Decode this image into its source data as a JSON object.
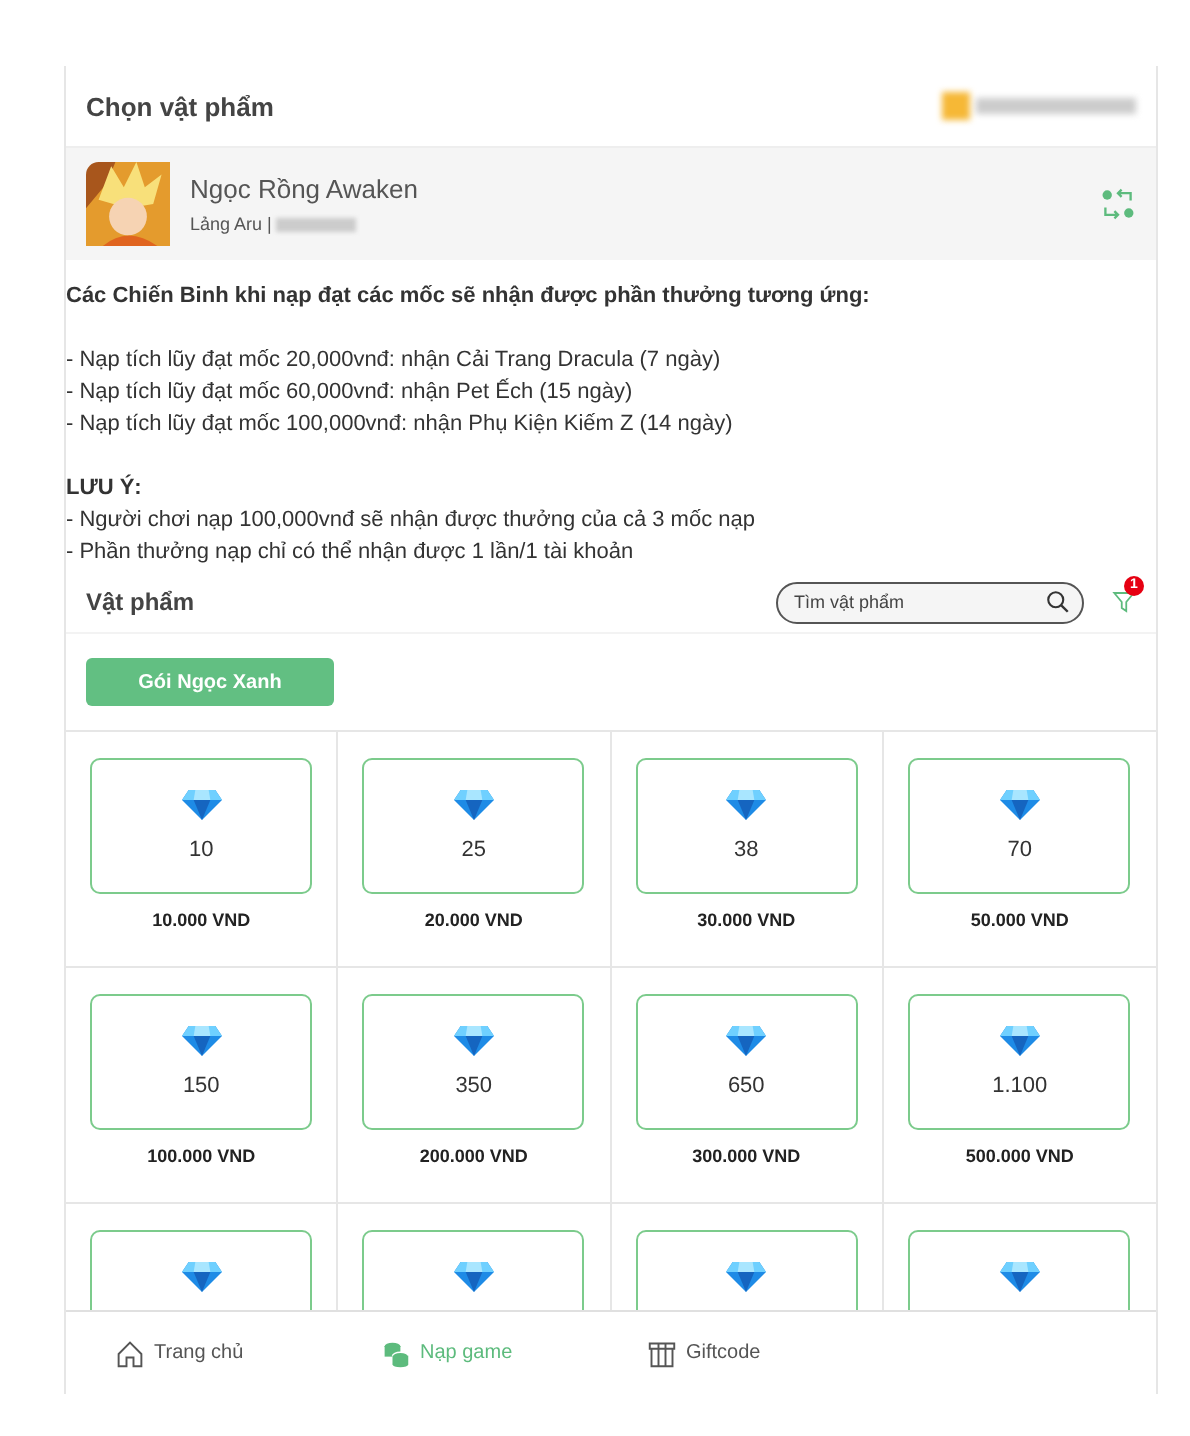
{
  "header": {
    "title": "Chọn vật phẩm"
  },
  "game": {
    "name": "Ngọc Rồng Awaken",
    "server": "Lảng Aru |"
  },
  "notice": {
    "heading": "Các Chiến Binh khi nạp đạt các mốc sẽ nhận được phần thưởng tương ứng:",
    "rewards": [
      "- Nạp tích lũy đạt mốc 20,000vnđ: nhận Cải Trang Dracula (7 ngày)",
      "- Nạp tích lũy đạt mốc 60,000vnđ: nhận Pet Ếch (15 ngày)",
      "- Nạp tích lũy đạt mốc 100,000vnđ: nhận Phụ Kiện Kiếm Z (14 ngày)"
    ],
    "note_heading": "LƯU Ý:",
    "notes": [
      "- Người chơi nạp 100,000vnđ sẽ nhận được thưởng của cả 3 mốc nạp",
      "- Phần thưởng nạp chỉ có thể nhận được 1 lần/1 tài khoản"
    ]
  },
  "items_section": {
    "title": "Vật phẩm",
    "search": {
      "placeholder": "Tìm vật phẩm"
    },
    "filter_badge": "1",
    "category_button": "Gói Ngọc Xanh"
  },
  "items": [
    {
      "kind": "full",
      "amount": "10",
      "price": "10.000 VND"
    },
    {
      "kind": "full",
      "amount": "25",
      "price": "20.000 VND"
    },
    {
      "kind": "full",
      "amount": "38",
      "price": "30.000 VND"
    },
    {
      "kind": "full",
      "amount": "70",
      "price": "50.000 VND"
    },
    {
      "kind": "full",
      "amount": "150",
      "price": "100.000 VND"
    },
    {
      "kind": "full",
      "amount": "350",
      "price": "200.000 VND"
    },
    {
      "kind": "full",
      "amount": "650",
      "price": "300.000 VND"
    },
    {
      "kind": "full",
      "amount": "1.100",
      "price": "500.000 VND"
    },
    {
      "kind": "partial"
    },
    {
      "kind": "partial"
    },
    {
      "kind": "partial"
    },
    {
      "kind": "partial"
    }
  ],
  "nav": [
    {
      "label": "Trang chủ",
      "selected": false
    },
    {
      "label": "Nạp game",
      "selected": true
    },
    {
      "label": "Giftcode",
      "selected": false
    }
  ]
}
